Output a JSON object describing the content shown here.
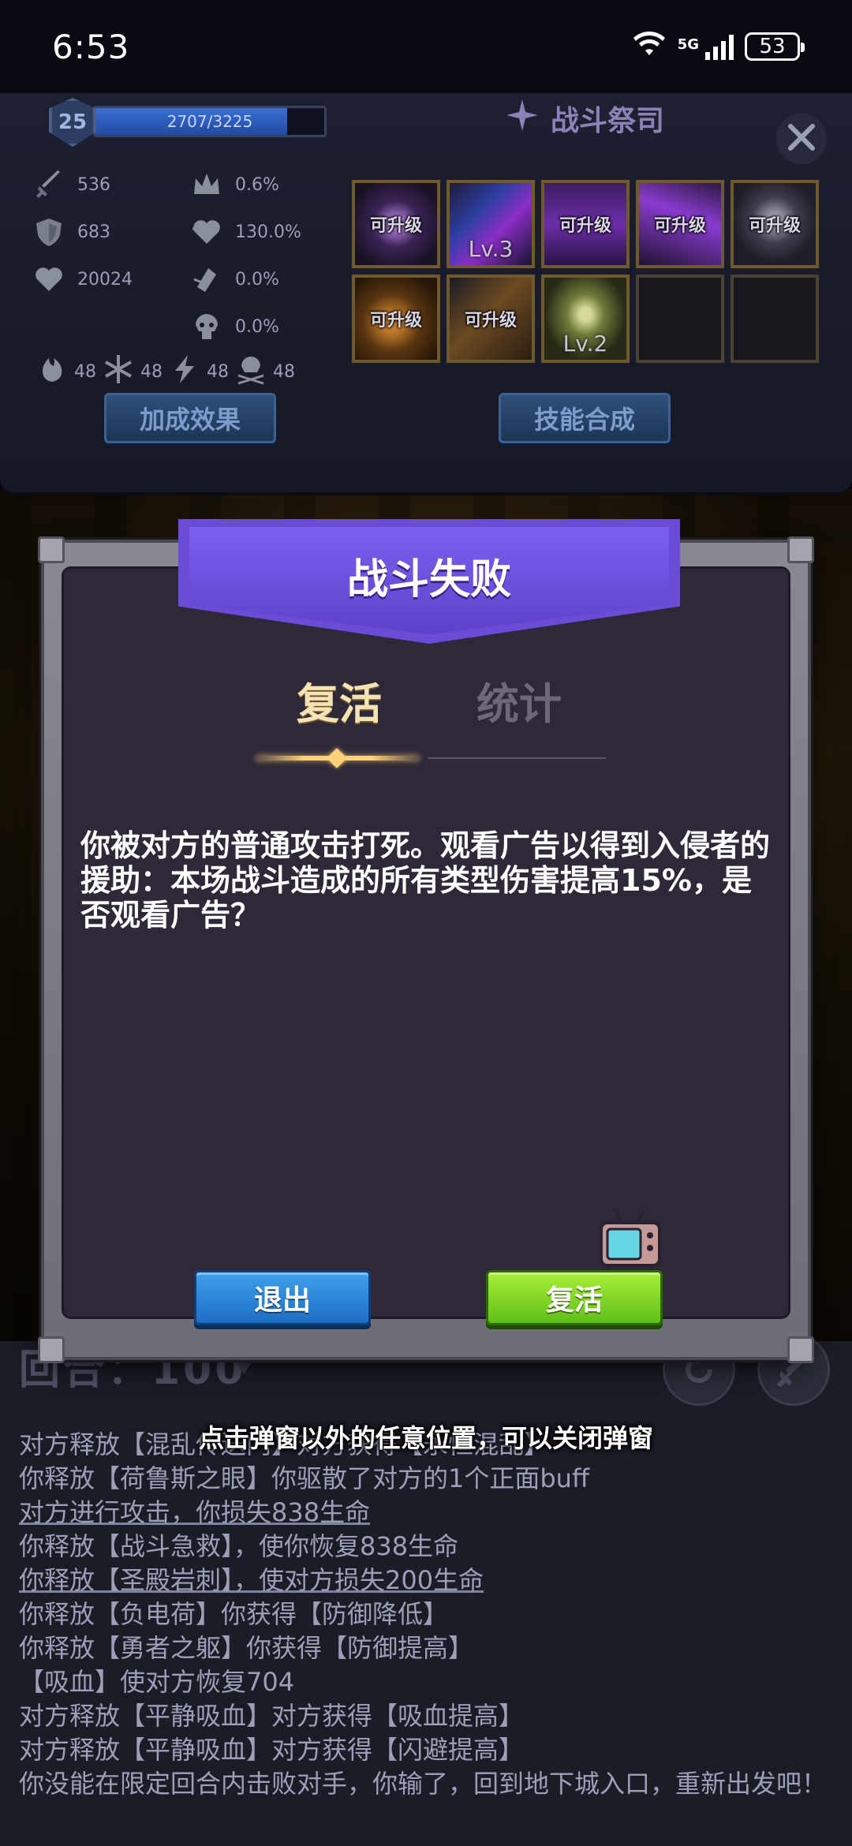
{
  "status_bar": {
    "time": "6:53",
    "network_badge": "5G",
    "battery": "53",
    "icons": [
      "wifi-icon",
      "signal-icon",
      "signal-off-icon",
      "battery-icon"
    ]
  },
  "player_panel": {
    "level": "25",
    "exp_text": "2707/3225",
    "exp_fill_fraction": 0.839,
    "stats_left": [
      {
        "icon": "sword-icon",
        "value": "536"
      },
      {
        "icon": "shield-icon",
        "value": "683"
      },
      {
        "icon": "heart-icon",
        "value": "20024"
      }
    ],
    "stats_right": [
      {
        "icon": "crown-icon",
        "value": "0.6%"
      },
      {
        "icon": "heart-drain-icon",
        "value": "130.0%"
      },
      {
        "icon": "evade-icon",
        "value": "0.0%"
      },
      {
        "icon": "skull-icon",
        "value": "0.0%"
      }
    ],
    "elements": [
      {
        "icon": "fire-icon",
        "value": "48"
      },
      {
        "icon": "frost-icon",
        "value": "48"
      },
      {
        "icon": "lightning-icon",
        "value": "48"
      },
      {
        "icon": "poison-skull-icon",
        "value": "48"
      }
    ],
    "bonus_button": "加成效果",
    "class_title": "战斗祭司",
    "synthesis_button": "技能合成",
    "skills": [
      {
        "label": "可升级",
        "level": ""
      },
      {
        "label": "",
        "level": "Lv.3"
      },
      {
        "label": "可升级",
        "level": ""
      },
      {
        "label": "可升级",
        "level": ""
      },
      {
        "label": "可升级",
        "level": ""
      },
      {
        "label": "可升级",
        "level": ""
      },
      {
        "label": "可升级",
        "level": ""
      },
      {
        "label": "",
        "level": "Lv.2"
      },
      {
        "label": "",
        "level": ""
      },
      {
        "label": "",
        "level": ""
      }
    ]
  },
  "modal": {
    "title": "战斗失败",
    "tabs": [
      {
        "label": "复活",
        "active": true
      },
      {
        "label": "统计",
        "active": false
      }
    ],
    "message": "你被对方的普通攻击打死。观看广告以得到入侵者的援助：本场战斗造成的所有类型伤害提高15%，是否观看广告？",
    "exit_button": "退出",
    "revive_button": "复活"
  },
  "log": {
    "round_label": "回合：100",
    "hint": "点击弹窗以外的任意位置，可以关闭弹窗",
    "lines": [
      {
        "text": "对方释放【混乱传送门】对方获得【永恒混乱】",
        "underline": false
      },
      {
        "text": "你释放【荷鲁斯之眼】你驱散了对方的1个正面buff",
        "underline": false
      },
      {
        "text": "对方进行攻击，你损失838生命",
        "underline": true
      },
      {
        "text": "你释放【战斗急救】，使你恢复838生命",
        "underline": false
      },
      {
        "text": "你释放【圣殿岩刺】，使对方损失200生命",
        "underline": true
      },
      {
        "text": "你释放【负电荷】你获得【防御降低】",
        "underline": false
      },
      {
        "text": "你释放【勇者之躯】你获得【防御提高】",
        "underline": false
      },
      {
        "text": "【吸血】使对方恢复704",
        "underline": false
      },
      {
        "text": "对方释放【平静吸血】对方获得【吸血提高】",
        "underline": false
      },
      {
        "text": "对方释放【平静吸血】对方获得【闪避提高】",
        "underline": false
      },
      {
        "text": "你没能在限定回合内击败对手，你输了，回到地下城入口，重新出发吧！",
        "underline": false
      }
    ]
  },
  "colors": {
    "banner": "#6a4cd7",
    "active_tab": "#f6e3b4",
    "exit_button": "#1d6ec2",
    "revive_button": "#5fbf17"
  }
}
